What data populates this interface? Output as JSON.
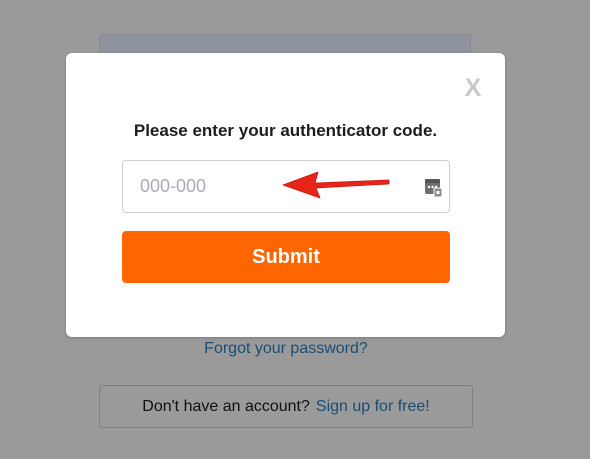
{
  "modal": {
    "close_label": "X",
    "title": "Please enter your authenticator code.",
    "code_input": {
      "value": "",
      "placeholder": "000-000"
    },
    "submit_label": "Submit",
    "keychain_icon": "password-keychain-icon",
    "annotation_icon": "red-arrow-icon"
  },
  "background": {
    "forgot_password_link": "Forgot your password?",
    "signup_prompt": "Don't have an account?",
    "signup_link": "Sign up for free!"
  },
  "colors": {
    "overlay": "#9a9a9a",
    "submit_bg": "#ff6600",
    "link": "#1a4e74",
    "arrow": "#e8251b"
  }
}
